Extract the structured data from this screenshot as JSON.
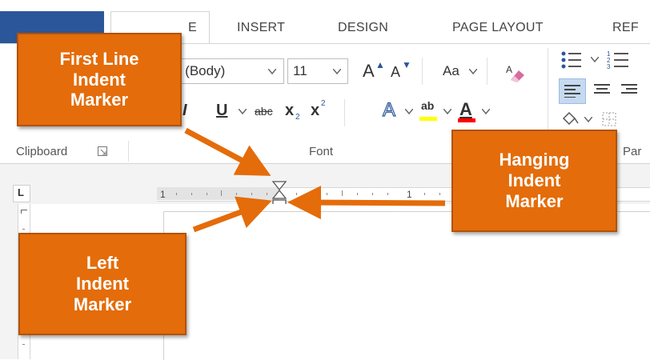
{
  "ribbon": {
    "tabs": [
      {
        "label": "E"
      },
      {
        "label": "INSERT"
      },
      {
        "label": "DESIGN"
      },
      {
        "label": "PAGE LAYOUT"
      },
      {
        "label": "REF"
      }
    ],
    "font": {
      "name_value": "ri (Body)",
      "size_value": "11",
      "change_case_label": "Aa",
      "grow_font_label": "A",
      "shrink_font_label": "A"
    },
    "formatting": {
      "italic_label": "I",
      "underline_label": "U",
      "strikethrough_label": "abc",
      "subscript_label": "x",
      "subscript_mark": "2",
      "superscript_label": "x",
      "superscript_mark": "2",
      "text_effects_label": "A",
      "highlight_label": "ab",
      "font_color_label": "A"
    },
    "groups": {
      "clipboard": "Clipboard",
      "font": "Font",
      "paragraph": "Par"
    }
  },
  "ruler": {
    "left_number": "1",
    "right_number": "1",
    "tab_selector": "L"
  },
  "callouts": {
    "first_line": [
      "First Line",
      "Indent",
      "Marker"
    ],
    "hanging": [
      "Hanging",
      "Indent",
      "Marker"
    ],
    "left": [
      "Left",
      "Indent",
      "Marker"
    ]
  },
  "colors": {
    "callout_fill": "#e46c0a",
    "file_tab": "#2b579a",
    "highlight_bar": "#ffff00",
    "font_color_bar": "#ff0000"
  },
  "icons": [
    "dialog-launcher-icon",
    "eraser-icon",
    "bullets-icon",
    "numbering-icon",
    "align-left-icon",
    "center-icon",
    "shading-icon",
    "borders-icon",
    "indent-marker-icon"
  ]
}
